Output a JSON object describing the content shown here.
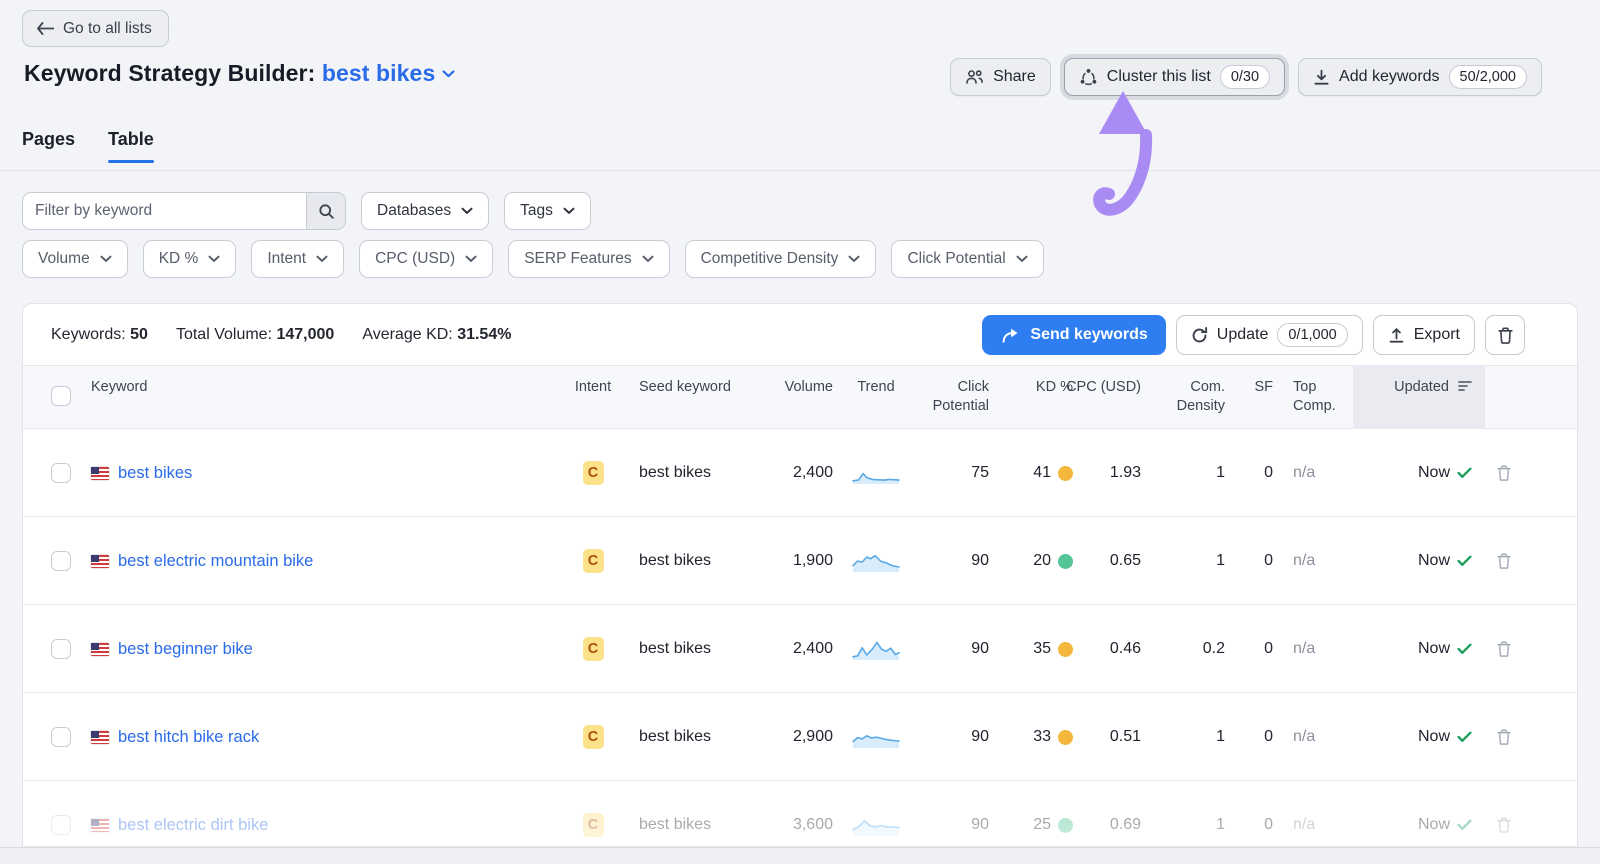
{
  "back_button": {
    "label": "Go to all lists"
  },
  "title": {
    "prefix": "Keyword Strategy Builder:",
    "list_name": "best bikes"
  },
  "actions": {
    "share_label": "Share",
    "cluster_label": "Cluster this list",
    "cluster_badge": "0/30",
    "add_label": "Add keywords",
    "add_badge": "50/2,000"
  },
  "tabs": [
    {
      "label": "Pages",
      "active": false
    },
    {
      "label": "Table",
      "active": true
    }
  ],
  "filters": {
    "search_placeholder": "Filter by keyword",
    "databases_label": "Databases",
    "tags_label": "Tags",
    "row2": [
      "Volume",
      "KD %",
      "Intent",
      "CPC (USD)",
      "SERP Features",
      "Competitive Density",
      "Click Potential"
    ]
  },
  "summary": {
    "keywords_label": "Keywords:",
    "keywords_value": "50",
    "total_volume_label": "Total Volume:",
    "total_volume_value": "147,000",
    "avg_kd_label": "Average KD:",
    "avg_kd_value": "31.54%"
  },
  "toolbar": {
    "send_label": "Send keywords",
    "update_label": "Update",
    "update_badge": "0/1,000",
    "export_label": "Export"
  },
  "table": {
    "columns": [
      "Keyword",
      "Intent",
      "Seed keyword",
      "Volume",
      "Trend",
      "Click Potential",
      "KD %",
      "CPC (USD)",
      "Com. Density",
      "SF",
      "Top Comp.",
      "Updated"
    ],
    "rows": [
      {
        "keyword": "best bikes",
        "intent": "C",
        "seed_keyword": "best bikes",
        "volume": "2,400",
        "click_potential": "75",
        "kd": "41",
        "kd_dot": "#f5b63d",
        "cpc": "1.93",
        "com_density": "1",
        "sf": "0",
        "top_comp": "n/a",
        "updated": "Now",
        "trend_points": [
          [
            0,
            0.12
          ],
          [
            0.12,
            0.16
          ],
          [
            0.22,
            0.52
          ],
          [
            0.3,
            0.3
          ],
          [
            0.42,
            0.2
          ],
          [
            0.55,
            0.18
          ],
          [
            0.68,
            0.16
          ],
          [
            0.8,
            0.2
          ],
          [
            1,
            0.16
          ]
        ]
      },
      {
        "keyword": "best electric mountain bike",
        "intent": "C",
        "seed_keyword": "best bikes",
        "volume": "1,900",
        "click_potential": "90",
        "kd": "20",
        "kd_dot": "#55c496",
        "cpc": "0.65",
        "com_density": "1",
        "sf": "0",
        "top_comp": "n/a",
        "updated": "Now",
        "trend_points": [
          [
            0,
            0.3
          ],
          [
            0.1,
            0.55
          ],
          [
            0.2,
            0.5
          ],
          [
            0.3,
            0.78
          ],
          [
            0.38,
            0.68
          ],
          [
            0.48,
            0.85
          ],
          [
            0.6,
            0.55
          ],
          [
            0.72,
            0.45
          ],
          [
            0.85,
            0.3
          ],
          [
            1,
            0.22
          ]
        ]
      },
      {
        "keyword": "best beginner bike",
        "intent": "C",
        "seed_keyword": "best bikes",
        "volume": "2,400",
        "click_potential": "90",
        "kd": "35",
        "kd_dot": "#f5b63d",
        "cpc": "0.46",
        "com_density": "0.2",
        "sf": "0",
        "top_comp": "n/a",
        "updated": "Now",
        "trend_points": [
          [
            0,
            0.12
          ],
          [
            0.1,
            0.18
          ],
          [
            0.2,
            0.62
          ],
          [
            0.3,
            0.22
          ],
          [
            0.42,
            0.55
          ],
          [
            0.52,
            0.92
          ],
          [
            0.62,
            0.55
          ],
          [
            0.72,
            0.42
          ],
          [
            0.82,
            0.6
          ],
          [
            0.92,
            0.25
          ],
          [
            1,
            0.35
          ]
        ]
      },
      {
        "keyword": "best hitch bike rack",
        "intent": "C",
        "seed_keyword": "best bikes",
        "volume": "2,900",
        "click_potential": "90",
        "kd": "33",
        "kd_dot": "#f5b63d",
        "cpc": "0.51",
        "com_density": "1",
        "sf": "0",
        "top_comp": "n/a",
        "updated": "Now",
        "trend_points": [
          [
            0,
            0.3
          ],
          [
            0.1,
            0.52
          ],
          [
            0.2,
            0.45
          ],
          [
            0.3,
            0.62
          ],
          [
            0.4,
            0.5
          ],
          [
            0.5,
            0.55
          ],
          [
            0.62,
            0.48
          ],
          [
            0.75,
            0.4
          ],
          [
            0.88,
            0.36
          ],
          [
            1,
            0.33
          ]
        ]
      },
      {
        "keyword": "best electric dirt bike",
        "intent": "C",
        "seed_keyword": "best bikes",
        "volume": "3,600",
        "click_potential": "90",
        "kd": "25",
        "kd_dot": "#55c496",
        "cpc": "0.69",
        "com_density": "1",
        "sf": "0",
        "top_comp": "n/a",
        "updated": "Now",
        "trend_points": [
          [
            0,
            0.3
          ],
          [
            0.12,
            0.45
          ],
          [
            0.25,
            0.78
          ],
          [
            0.38,
            0.5
          ],
          [
            0.5,
            0.45
          ],
          [
            0.6,
            0.52
          ],
          [
            0.75,
            0.45
          ],
          [
            1,
            0.42
          ]
        ]
      }
    ]
  },
  "colors": {
    "accent_blue": "#2a6be8",
    "send_button_blue": "#2e7ef2",
    "tab_underline": "#2573e8",
    "annotation_arrow_purple": "#a98bf3",
    "intent_badge_bg": "#fbe18a",
    "intent_badge_text": "#a8500f",
    "kd_orange": "#f5b63d",
    "kd_green": "#55c496",
    "check_green": "#1f9d61",
    "sparkline_line": "#58a9e8",
    "sparkline_fill": "#d9ecfb"
  }
}
